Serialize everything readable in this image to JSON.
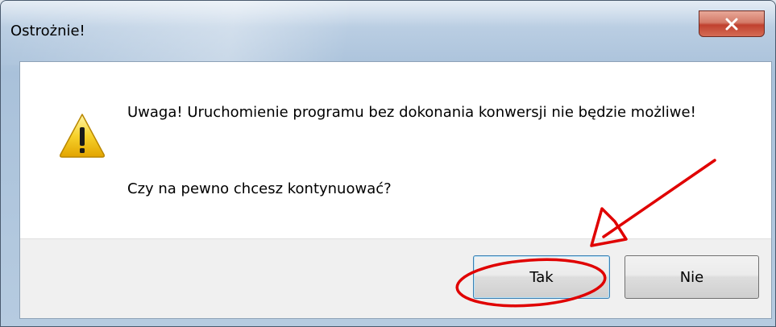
{
  "dialog": {
    "title": "Ostrożnie!",
    "close_icon": "close-icon",
    "icon": "warning-icon",
    "message": "Uwaga! Uruchomienie programu bez dokonania konwersji nie będzie możliwe!",
    "question": "Czy na pewno chcesz kontynuować?",
    "buttons": {
      "yes_label": "Tak",
      "no_label": "Nie"
    }
  },
  "annotation": {
    "type": "red-ellipse-and-arrow",
    "color": "#e00000",
    "target": "yes-button"
  },
  "colors": {
    "close_button": "#c0412f",
    "focus_border": "#3c7fb1",
    "footer_bg": "#f0f0f0"
  }
}
